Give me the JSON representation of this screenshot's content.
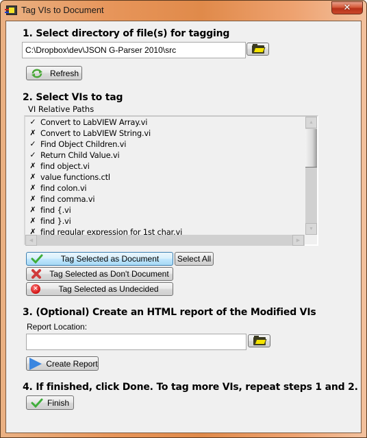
{
  "window": {
    "title": "Tag VIs to Document",
    "close_label": "x"
  },
  "step1": {
    "heading": "1. Select directory of file(s) for tagging",
    "directory_value": "C:\\Dropbox\\dev\\JSON G-Parser 2010\\src",
    "refresh_label": "Refresh"
  },
  "step2": {
    "heading": "2. Select VIs to tag",
    "list_header": "VI Relative Paths",
    "items": [
      {
        "mark": "✓",
        "name": "Convert to LabVIEW Array.vi"
      },
      {
        "mark": "✗",
        "name": "Convert to LabVIEW String.vi"
      },
      {
        "mark": "✓",
        "name": "Find Object Children.vi"
      },
      {
        "mark": "✓",
        "name": "Return Child Value.vi"
      },
      {
        "mark": "✗",
        "name": "find object.vi"
      },
      {
        "mark": "✗",
        "name": "value functions.ctl"
      },
      {
        "mark": "✗",
        "name": "find colon.vi"
      },
      {
        "mark": "✗",
        "name": "find comma.vi"
      },
      {
        "mark": "✗",
        "name": "find {.vi"
      },
      {
        "mark": "✗",
        "name": "find }.vi"
      },
      {
        "mark": "✗",
        "name": "find regular expression for 1st char.vi"
      }
    ],
    "tag_document_label": "Tag Selected as Document",
    "select_all_label": "Select All",
    "tag_dont_document_label": "Tag Selected as Don't Document",
    "tag_undecided_label": "Tag Selected as Undecided"
  },
  "step3": {
    "heading": "3. (Optional) Create an HTML report of the  Modified VIs",
    "report_location_label": "Report Location:",
    "report_location_value": "",
    "create_report_label": "Create Report"
  },
  "step4": {
    "heading": "4.    If finished, click Done. To tag more VIs, repeat steps 1 and 2.",
    "finish_label": "Finish"
  }
}
